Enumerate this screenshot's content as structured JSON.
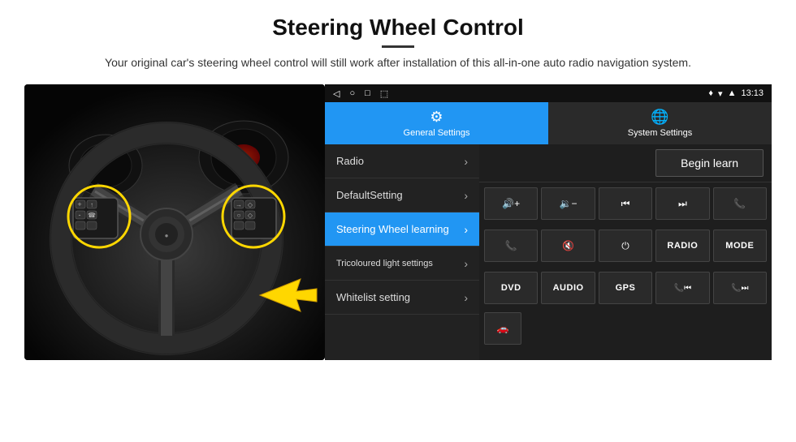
{
  "header": {
    "title": "Steering Wheel Control",
    "subtitle": "Your original car's steering wheel control will still work after installation of this all-in-one auto radio navigation system."
  },
  "status_bar": {
    "time": "13:13",
    "icons": [
      "◁",
      "○",
      "□",
      "⬜"
    ]
  },
  "tabs": [
    {
      "id": "general",
      "label": "General Settings",
      "icon": "⚙",
      "active": true
    },
    {
      "id": "system",
      "label": "System Settings",
      "icon": "🌐",
      "active": false
    }
  ],
  "menu_items": [
    {
      "id": "radio",
      "label": "Radio",
      "active": false
    },
    {
      "id": "default",
      "label": "DefaultSetting",
      "active": false
    },
    {
      "id": "steering",
      "label": "Steering Wheel learning",
      "active": true
    },
    {
      "id": "tricoloured",
      "label": "Tricoloured light settings",
      "active": false
    },
    {
      "id": "whitelist",
      "label": "Whitelist setting",
      "active": false
    }
  ],
  "begin_learn_label": "Begin learn",
  "control_buttons": [
    {
      "id": "vol_up",
      "label": "🔊+",
      "type": "icon"
    },
    {
      "id": "vol_down",
      "label": "🔉-",
      "type": "icon"
    },
    {
      "id": "prev_track",
      "label": "⏮",
      "type": "icon"
    },
    {
      "id": "next_track",
      "label": "⏭",
      "type": "icon"
    },
    {
      "id": "phone",
      "label": "📞",
      "type": "icon"
    },
    {
      "id": "answer",
      "label": "📞",
      "type": "icon"
    },
    {
      "id": "mute",
      "label": "🔇",
      "type": "icon"
    },
    {
      "id": "power",
      "label": "⏻",
      "type": "icon"
    },
    {
      "id": "radio_btn",
      "label": "RADIO",
      "type": "text"
    },
    {
      "id": "mode_btn",
      "label": "MODE",
      "type": "text"
    },
    {
      "id": "dvd_btn",
      "label": "DVD",
      "type": "text"
    },
    {
      "id": "audio_btn",
      "label": "AUDIO",
      "type": "text"
    },
    {
      "id": "gps_btn",
      "label": "GPS",
      "type": "text"
    },
    {
      "id": "phone2",
      "label": "📞⏮",
      "type": "icon"
    },
    {
      "id": "phone3",
      "label": "📞⏭",
      "type": "icon"
    }
  ],
  "bottom_icon": "🚗"
}
